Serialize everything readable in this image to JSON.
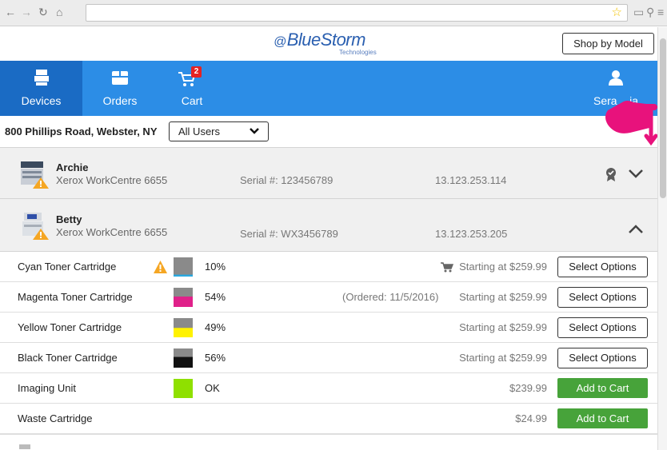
{
  "header": {
    "logo_text": "BlueStorm",
    "logo_subtext": "Technologies",
    "shop_by_model": "Shop by Model"
  },
  "nav": {
    "devices": "Devices",
    "orders": "Orders",
    "cart": "Cart",
    "cart_count": "2",
    "user": "Sera    ia"
  },
  "filter": {
    "address": "800 Phillips Road, Webster, NY",
    "users_selected": "All Users"
  },
  "devices": [
    {
      "name": "Archie",
      "model": "Xerox WorkCentre 6655",
      "serial": "Serial #: 123456789",
      "ip": "13.123.253.114"
    },
    {
      "name": "Betty",
      "model": "Xerox WorkCentre 6655",
      "serial": "Serial #: WX3456789",
      "ip": "13.123.253.205"
    }
  ],
  "supplies": [
    {
      "name": "Cyan Toner Cartridge",
      "level": "10%",
      "ordered": "",
      "price": "Starting at $259.99",
      "button": "Select Options",
      "color": "#29a9e0",
      "fill": 0.1
    },
    {
      "name": "Magenta Toner Cartridge",
      "level": "54%",
      "ordered": "(Ordered: 11/5/2016)",
      "price": "Starting at $259.99",
      "button": "Select Options",
      "color": "#e0218a",
      "fill": 0.54
    },
    {
      "name": "Yellow Toner Cartridge",
      "level": "49%",
      "ordered": "",
      "price": "Starting at $259.99",
      "button": "Select Options",
      "color": "#fff200",
      "fill": 0.49
    },
    {
      "name": "Black Toner Cartridge",
      "level": "56%",
      "ordered": "",
      "price": "Starting at $259.99",
      "button": "Select Options",
      "color": "#111111",
      "fill": 0.56
    },
    {
      "name": "Imaging Unit",
      "level": "OK",
      "ordered": "",
      "price": "$239.99",
      "button": "Add to Cart",
      "color": "#8fe000",
      "fill": 1.0
    },
    {
      "name": "Waste Cartridge",
      "level": "",
      "ordered": "",
      "price": "$24.99",
      "button": "Add to Cart",
      "color": "",
      "fill": 0
    }
  ],
  "colors": {
    "nav_blue": "#2c8de6",
    "nav_active": "#1a6bc4",
    "cart_green": "#47a33a",
    "warning": "#f5a623",
    "pointer_pink": "#e8127c"
  }
}
